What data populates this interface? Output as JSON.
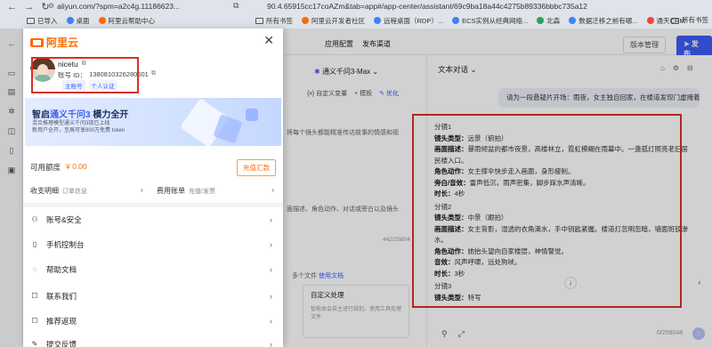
{
  "browser": {
    "url": "aliyun.com/?spm=a2c4g.11186623...",
    "url_right": "90.4.65915cc17coAZm&tab=app#/app-center/assistant/69c9ba18a44c4275b89336bbbc735a12",
    "bookmarks": [
      "已导入",
      "桌面",
      "阿里云帮助中心",
      "所有书签",
      "阿里云开发者社区",
      "远程桌面（RDP）...",
      "ECS实例从经典网络...",
      "北森",
      "数据迁移之前有哪...",
      "通天CRM"
    ],
    "bookmarks_right": "所有书签"
  },
  "drawer": {
    "logo": "阿里云",
    "user": {
      "name": "nicetu",
      "account_label": "账号 ID：",
      "account_id": "1380810326280501",
      "badges": [
        "主账号",
        "个人认证"
      ]
    },
    "banner": {
      "title_prefix": "智启",
      "title_accent": "通义千问3",
      "title_suffix": " 模力全开",
      "subtitle": "混合推理模型通义千问3现已上线\n新用户全开，至高可享800万免费 token"
    },
    "quota_label": "可用额度",
    "quota_value": "¥ 0.00",
    "recharge_label": "充值汇款",
    "orders_label": "收支明细",
    "orders_sub": "订单信息",
    "bills_label": "费用账单",
    "bills_sub": "充值/发票",
    "menu": [
      "账号&安全",
      "手机控制台",
      "帮助文档",
      "联系我们",
      "推荐返现",
      "提交反馈"
    ]
  },
  "app": {
    "tabs": [
      "应用配置",
      "发布渠道"
    ],
    "version_btn": "版本管理",
    "publish_btn": "发布",
    "model": "通义千问3-Max",
    "tools": [
      "自定义变量",
      "模板",
      "优化"
    ],
    "mid_text1": "将每个镜头都能精准传达故事的情感和视",
    "mid_text2": "面描述、角色动作、对话或旁白以及镜头",
    "mid_counter": "442/25804",
    "mid_link_prefix": "多个文件",
    "mid_link": "使用文档",
    "card_title": "自定义处理",
    "card_sub": "智能体会自主进行规划，使用工具处理文件",
    "chat_title": "文本对话",
    "user_msg": "请为一段悬疑片开场：雨夜，女主独自回家，在楼道发现门虚掩着。",
    "answer": [
      {
        "type": "head",
        "text": "分镜1"
      },
      {
        "type": "field",
        "k": "镜头类型：",
        "v": "远景（俯拍）"
      },
      {
        "type": "field",
        "k": "画面描述：",
        "v": "暴雨倾盆的都市夜景，高楼林立，霓虹模糊在雨幕中。一盏孤灯照亮老旧居民楼入口。"
      },
      {
        "type": "field",
        "k": "角色动作：",
        "v": "女主撑伞快步走入画面，身形瘦削。"
      },
      {
        "type": "field",
        "k": "旁白/音效：",
        "v": "雷声低沉，雨声密集，脚步踩水声清晰。"
      },
      {
        "type": "field",
        "k": "时长：",
        "v": "4秒"
      },
      {
        "type": "head",
        "text": "分镜2"
      },
      {
        "type": "field",
        "k": "镜头类型：",
        "v": "中景（跟拍）"
      },
      {
        "type": "field",
        "k": "画面描述：",
        "v": "女主背影，湿透的衣角滴水，手中钥匙紧握。楼道灯忽明忽暗，墙面斑驳渗水。"
      },
      {
        "type": "field",
        "k": "角色动作：",
        "v": "她抬头望向自家楼层，神情警觉。"
      },
      {
        "type": "field",
        "k": "音效：",
        "v": "风声呼啸，远处狗吠。"
      },
      {
        "type": "field",
        "k": "时长：",
        "v": "3秒"
      },
      {
        "type": "head",
        "text": "分镜3"
      },
      {
        "type": "field",
        "k": "镜头类型：",
        "v": "特写"
      }
    ],
    "input_count": "0/258048"
  }
}
